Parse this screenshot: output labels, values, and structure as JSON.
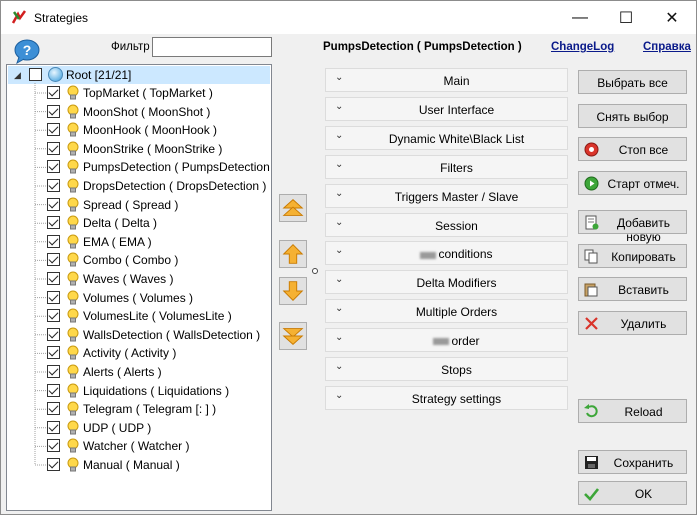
{
  "window": {
    "title": "Strategies",
    "controls": {
      "minimize": "—",
      "maximize": "☐",
      "close": "✕"
    }
  },
  "filter": {
    "label": "Фильтр",
    "value": ""
  },
  "tree": {
    "root_label": "Root [21/21]",
    "items": [
      {
        "label": "TopMarket  ( TopMarket )",
        "checked": true
      },
      {
        "label": "MoonShot  ( MoonShot )",
        "checked": true
      },
      {
        "label": "MoonHook  ( MoonHook )",
        "checked": true
      },
      {
        "label": "MoonStrike  ( MoonStrike )",
        "checked": true
      },
      {
        "label": "PumpsDetection  ( PumpsDetection )",
        "checked": true
      },
      {
        "label": "DropsDetection  ( DropsDetection )",
        "checked": true
      },
      {
        "label": "Spread  ( Spread )",
        "checked": true
      },
      {
        "label": "Delta  ( Delta )",
        "checked": true
      },
      {
        "label": "EMA  ( EMA )",
        "checked": true
      },
      {
        "label": "Combo  ( Combo )",
        "checked": true
      },
      {
        "label": "Waves  ( Waves )",
        "checked": true
      },
      {
        "label": "Volumes  ( Volumes )",
        "checked": true
      },
      {
        "label": "VolumesLite  ( VolumesLite )",
        "checked": true
      },
      {
        "label": "WallsDetection  ( WallsDetection )",
        "checked": true
      },
      {
        "label": "Activity  ( Activity )",
        "checked": true
      },
      {
        "label": "Alerts  ( Alerts )",
        "checked": true
      },
      {
        "label": "Liquidations  ( Liquidations )",
        "checked": true
      },
      {
        "label": "Telegram  ( Telegram [: ] )",
        "checked": true
      },
      {
        "label": "UDP  ( UDP )",
        "checked": true
      },
      {
        "label": "Watcher  ( Watcher )",
        "checked": true
      },
      {
        "label": "Manual  ( Manual )",
        "checked": true
      }
    ]
  },
  "header": {
    "strategy_title": "PumpsDetection  ( PumpsDetection )",
    "changelog_link": "ChangeLog",
    "help_link": "Справка"
  },
  "sections": [
    {
      "label": "Main"
    },
    {
      "label": "User Interface"
    },
    {
      "label": "Dynamic White\\Black List"
    },
    {
      "label": "Filters"
    },
    {
      "label": "Triggers  Master / Slave"
    },
    {
      "label": "Session"
    },
    {
      "label": "conditions",
      "redacted_prefix": true
    },
    {
      "label": "Delta Modifiers"
    },
    {
      "label": "Multiple Orders"
    },
    {
      "label": "order",
      "redacted_prefix": true
    },
    {
      "label": "Stops"
    },
    {
      "label": "Strategy settings"
    }
  ],
  "buttons": {
    "select_all": "Выбрать все",
    "deselect": "Снять выбор",
    "stop_all": "Стоп все",
    "start_marked": "Старт отмеч.",
    "add_new": "Добавить новую",
    "copy": "Копировать",
    "paste": "Вставить",
    "delete": "Удалить",
    "reload": "Reload",
    "save": "Сохранить",
    "ok": "OK"
  },
  "icons": {
    "app": "strategies-app-icon",
    "help": "help-bubble-icon",
    "root": "globe-icon",
    "item": "lightbulb-icon",
    "move_top": "move-top-icon",
    "move_up": "move-up-icon",
    "move_down": "move-down-icon",
    "move_bottom": "move-bottom-icon"
  },
  "colors": {
    "selection": "#cce8ff",
    "arrow": "#f5a623",
    "link": "#0a1a8a",
    "stop": "#d9342b",
    "start": "#3da639",
    "delete": "#d9342b",
    "ok": "#3da639"
  }
}
